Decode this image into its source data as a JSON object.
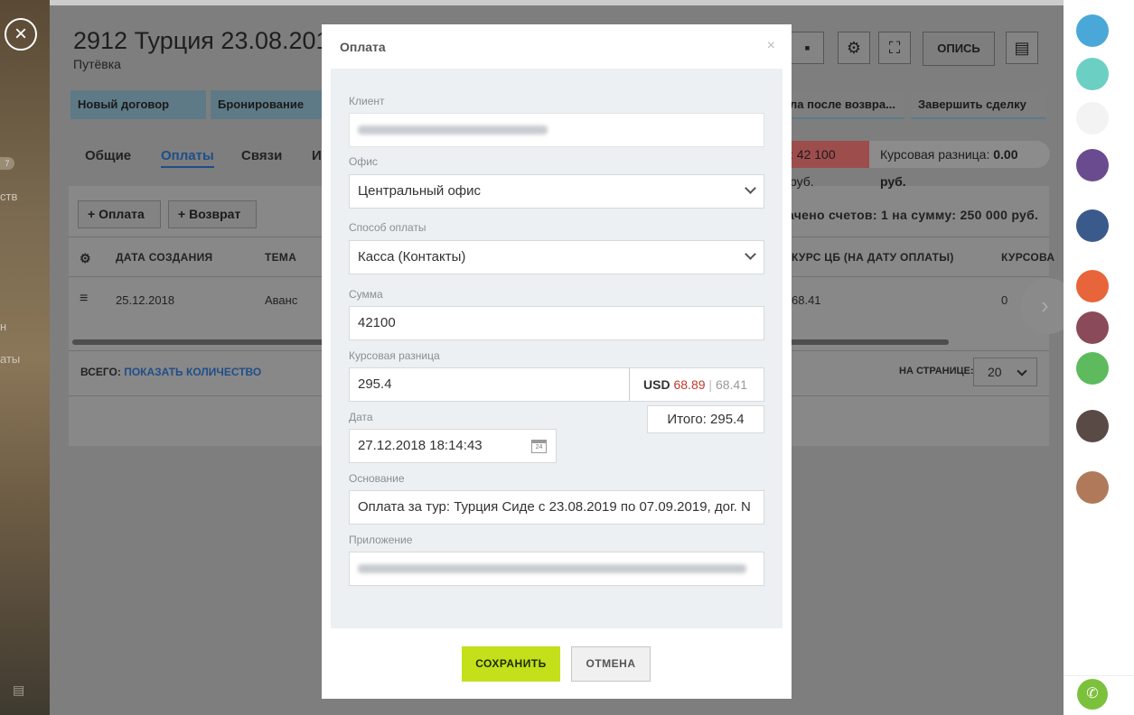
{
  "page": {
    "title": "2912 Турция 23.08.201",
    "subtitle": "Путёвка",
    "stages": [
      "Новый договор",
      "Бронирование",
      "ла после возвра...",
      "Завершить сделку"
    ],
    "tabs": [
      "Общие",
      "Оплаты",
      "Связи",
      "И"
    ],
    "active_tab": "Оплаты",
    "summary": {
      "paid": ": 42 100 руб.",
      "diff_label": "Курсовая разница: ",
      "diff_value": "0.00 руб."
    },
    "actions": {
      "payment": "Оплата",
      "refund": "Возврат"
    },
    "invoices_text": "ачено счетов: 1 на сумму: 250 000 руб.",
    "top_button": "ОПИСЬ",
    "table": {
      "headers": [
        "ДАТА СОЗДАНИЯ",
        "ТЕМА",
        "КУРС ЦБ (НА ДАТУ ОПЛАТЫ)",
        "КУРСОВА"
      ],
      "rows": [
        {
          "date": "25.12.2018",
          "topic": "Аванс",
          "rate": "68.41",
          "diff": "0"
        }
      ]
    },
    "footer": {
      "total_label": "ВСЕГО: ",
      "show_count": "ПОКАЗАТЬ КОЛИЧЕСТВО",
      "per_page_label": "НА СТРАНИЦЕ:",
      "per_page_value": "20"
    }
  },
  "left_strip": {
    "badge": "7",
    "items": [
      "ств",
      "н",
      "аты"
    ]
  },
  "modal": {
    "title": "Оплата",
    "close": "×",
    "client_label": "Клиент",
    "office_label": "Офис",
    "office_value": "Центральный офис",
    "method_label": "Способ оплаты",
    "method_value": "Касса (Контакты)",
    "sum_label": "Сумма",
    "sum_value": "42100",
    "diff_label": "Курсовая разница",
    "diff_value": "295.4",
    "currency": "USD",
    "rate": "68.89",
    "rate_sep": "|",
    "cb_rate": "68.41",
    "total": "Итого: 295.4",
    "date_label": "Дата",
    "date_value": "27.12.2018 18:14:43",
    "calendar_day": "24",
    "basis_label": "Основание",
    "basis_value": "Оплата за тур: Турция Сиде  с 23.08.2019 по 07.09.2019, дог. N",
    "attachment_label": "Приложение",
    "save": "СОХРАНИТЬ",
    "cancel": "ОТМЕНА"
  },
  "colors": {
    "save": "#c3e01a",
    "rate": "#c0392b",
    "tab_active": "#1f4e8a"
  }
}
